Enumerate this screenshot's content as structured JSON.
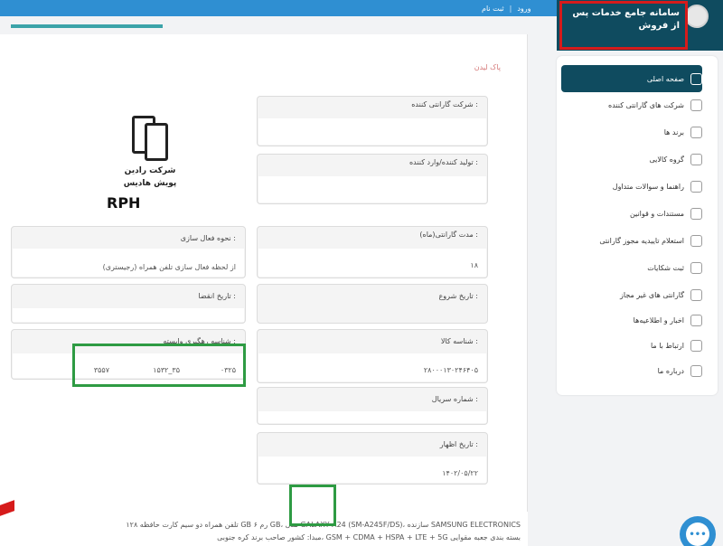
{
  "header": {
    "login_label": "ورود",
    "separator": "|",
    "register_label": "ثبت نام",
    "brand_title": "سامانه جامع خدمات پس از فروش"
  },
  "section_tag": "پاک لیدن",
  "sidebar": {
    "items": [
      {
        "label": "صفحه اصلی",
        "icon": "home-icon"
      },
      {
        "label": "شرکت های گارانتی کننده",
        "icon": "company-icon"
      },
      {
        "label": "برند ها",
        "icon": "tag-icon"
      },
      {
        "label": "گروه کالایی",
        "icon": "box-icon"
      },
      {
        "label": "راهنما و سوالات متداول",
        "icon": "help-icon"
      },
      {
        "label": "مستندات و قوانین",
        "icon": "document-icon"
      },
      {
        "label": "استعلام تاییدیه مجوز گارانتی",
        "icon": "verify-icon"
      },
      {
        "label": "ثبت شکایات",
        "icon": "complaint-icon"
      },
      {
        "label": "گارانتی های غیر مجاز",
        "icon": "forbidden-icon"
      },
      {
        "label": "اخبار و اطلاعیه‌ها",
        "icon": "news-icon"
      },
      {
        "label": "ارتباط با ما",
        "icon": "phone-icon"
      },
      {
        "label": "درباره ما",
        "icon": "info-icon"
      }
    ]
  },
  "form": {
    "warranty_company": {
      "label": "شرکت گارانتی کننده :",
      "value": ""
    },
    "manufacturer": {
      "label": "تولید کننده/وارد کننده :",
      "value": ""
    },
    "warranty_period": {
      "label": "مدت گارانتی(ماه) :",
      "value": "۱۸"
    },
    "start_date": {
      "label": "تاریخ شروع :",
      "value": ""
    },
    "product_id": {
      "label": "شناسه کالا :",
      "value": "۲۸۰۰۰۱۳۰۲۴۶۴۰۵"
    },
    "serial_number": {
      "label": "شماره سریال :",
      "value": ""
    },
    "declaration_date": {
      "label": "تاریخ اظهار :",
      "value": "۱۴۰۲/۰۵/۲۲"
    },
    "activation_method": {
      "label": "نحوه فعال سازی :",
      "value": "از لحظه فعال سازی تلفن همراه (رجیستری)"
    },
    "expiry_date": {
      "label": "تاریخ انقضا :",
      "value": ""
    },
    "tracking_ids": {
      "label": "شناسه رهگیری وابسته :",
      "values": [
        "۰۳۲۵",
        "۱۵۳۲_۳۵",
        "۳۵۵۷"
      ]
    }
  },
  "logo": {
    "company_line1": "شرکت رادین",
    "company_line2": "پویش هادیس",
    "abbrev": "RPH"
  },
  "description": {
    "line1": "تلفن همراه دو سیم کارت حافظه ۱۲۸ GB رم ۶ GB، مدل GALAXY A24 (SM-A245F/DS)، سازنده SAMSUNG ELECTRONICS",
    "line2": "مبدا: کشور صاحب برند کره جنوبی، GSM + CDMA + HSPA + LTE + 5G بسته بندی جعبه مقوایی",
    "highlight": "SAMSUNG"
  },
  "chat": {
    "label": "•••"
  }
}
